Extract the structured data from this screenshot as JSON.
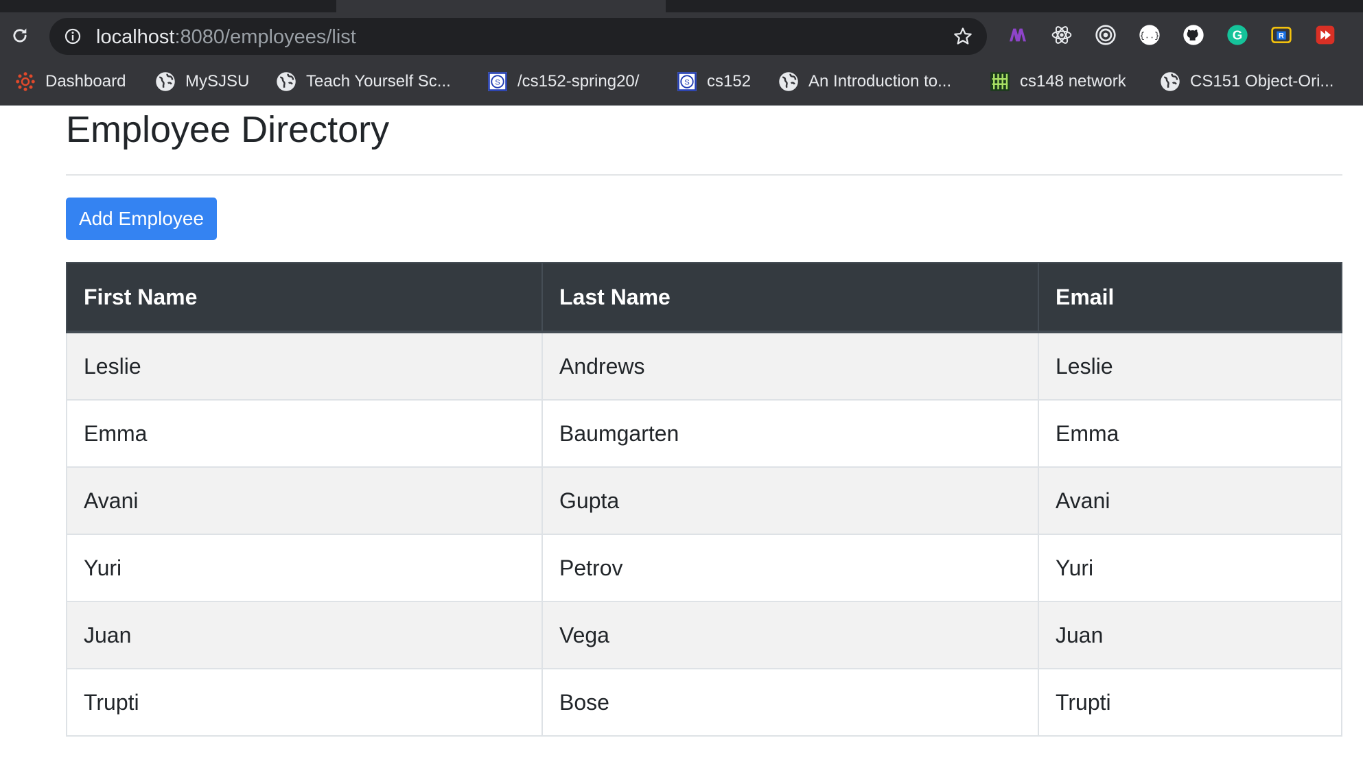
{
  "browser": {
    "url_host": "localhost",
    "url_path": ":8080/employees/list",
    "bookmarks": [
      {
        "label": "Dashboard",
        "icon": "canvas-icon"
      },
      {
        "label": "MySJSU",
        "icon": "globe-icon"
      },
      {
        "label": "Teach Yourself Sc...",
        "icon": "globe-icon"
      },
      {
        "label": "/cs152-spring20/",
        "icon": "sjsu-icon"
      },
      {
        "label": "cs152",
        "icon": "sjsu-icon"
      },
      {
        "label": "An Introduction to...",
        "icon": "globe-icon"
      },
      {
        "label": "cs148 network",
        "icon": "grid-icon"
      },
      {
        "label": "CS151 Object-Ori...",
        "icon": "globe-icon"
      }
    ],
    "extensions": [
      "m-extension-icon",
      "react-icon",
      "target-icon",
      "json-icon",
      "github-icon",
      "grammarly-icon",
      "r-extension-icon",
      "video-extension-icon"
    ]
  },
  "page": {
    "title": "Employee Directory",
    "add_button": "Add Employee"
  },
  "table": {
    "headers": [
      "First Name",
      "Last Name",
      "Email"
    ],
    "rows": [
      [
        "Leslie",
        "Andrews",
        "Leslie"
      ],
      [
        "Emma",
        "Baumgarten",
        "Emma"
      ],
      [
        "Avani",
        "Gupta",
        "Avani"
      ],
      [
        "Yuri",
        "Petrov",
        "Yuri"
      ],
      [
        "Juan",
        "Vega",
        "Juan"
      ],
      [
        "Trupti",
        "Bose",
        "Trupti"
      ]
    ]
  },
  "colors": {
    "accent": "#3483f2",
    "table_header": "#343a40",
    "stripe": "#f2f2f2"
  }
}
